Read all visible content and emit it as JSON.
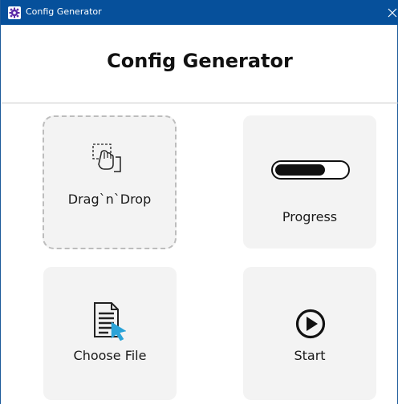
{
  "window": {
    "title": "Config Generator",
    "colors": {
      "titlebar": "#06509b",
      "tile_bg": "#f3f3f3",
      "accent": "#2aa3d8"
    }
  },
  "header": {
    "title": "Config Generator"
  },
  "tiles": {
    "drop": {
      "label": "Drag`n`Drop",
      "icon": "drag-drop-hand-icon"
    },
    "progress": {
      "label": "Progress",
      "icon": "progress-bar-icon",
      "progress": 0.7
    },
    "choose": {
      "label": "Choose File",
      "icon": "file-pointer-icon"
    },
    "start": {
      "label": "Start",
      "icon": "play-circle-icon"
    }
  }
}
